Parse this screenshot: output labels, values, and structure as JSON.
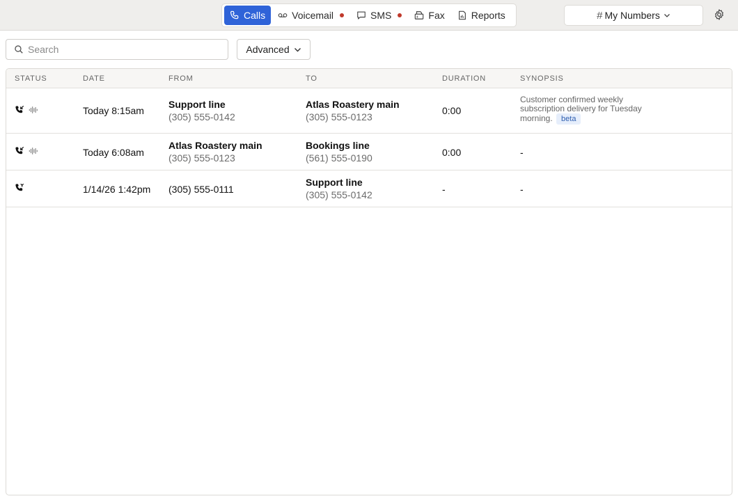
{
  "tabs": [
    {
      "label": "Calls",
      "icon": "phone-icon",
      "active": true,
      "dot": false
    },
    {
      "label": "Voicemail",
      "icon": "voicemail-icon",
      "active": false,
      "dot": true
    },
    {
      "label": "SMS",
      "icon": "message-icon",
      "active": false,
      "dot": true
    },
    {
      "label": "Fax",
      "icon": "fax-icon",
      "active": false,
      "dot": false
    },
    {
      "label": "Reports",
      "icon": "report-icon",
      "active": false,
      "dot": false
    }
  ],
  "numbers_selector": {
    "label": "My Numbers"
  },
  "search": {
    "placeholder": "Search",
    "value": ""
  },
  "advanced": {
    "label": "Advanced"
  },
  "columns": [
    "STATUS",
    "DATE",
    "FROM",
    "TO",
    "DURATION",
    "SYNOPSIS"
  ],
  "rows": [
    {
      "status_icons": [
        "incoming-call-icon",
        "audio-waveform-icon"
      ],
      "date": "Today 8:15am",
      "from_name": "Support line",
      "from_number": "(305) 555-0142",
      "to_name": "Atlas Roastery main",
      "to_number": "(305) 555-0123",
      "duration": "0:00",
      "synopsis": "Customer confirmed weekly subscription delivery for Tuesday morning.",
      "synopsis_badge": "beta"
    },
    {
      "status_icons": [
        "incoming-call-icon",
        "audio-waveform-icon"
      ],
      "date": "Today 6:08am",
      "from_name": "Atlas Roastery main",
      "from_number": "(305) 555-0123",
      "to_name": "Bookings line",
      "to_number": "(561) 555-0190",
      "duration": "0:00",
      "synopsis": "-"
    },
    {
      "status_icons": [
        "missed-call-icon"
      ],
      "date": "1/14/26 1:42pm",
      "from_name": "",
      "from_number": "(305) 555-0111",
      "to_name": "Support line",
      "to_number": "(305) 555-0142",
      "duration": "-",
      "synopsis": "-"
    }
  ],
  "colors": {
    "accent": "#2f63d8",
    "notification_dot": "#c0392b",
    "badge_bg": "#e6eefb"
  }
}
